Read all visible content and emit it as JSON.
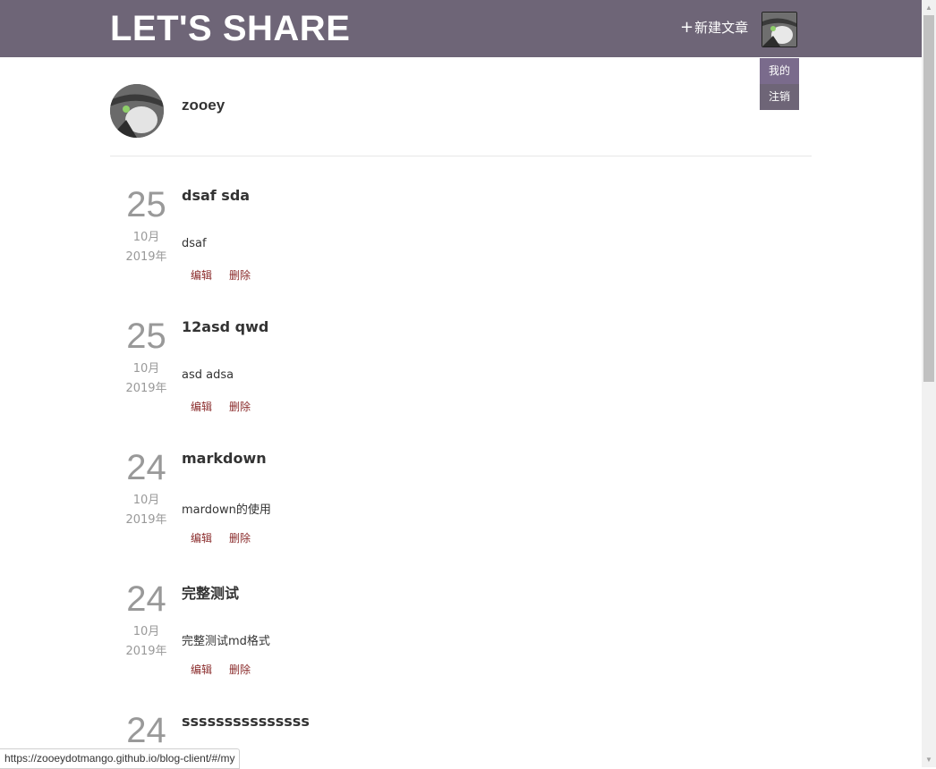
{
  "header": {
    "logo": "LET'S SHARE",
    "new_post_icon": "plus-icon",
    "new_post_label": "新建文章",
    "avatar_icon": "user-avatar-icon",
    "background_color": "#6e6577"
  },
  "user_menu": {
    "items": [
      {
        "label": "我的"
      },
      {
        "label": "注销"
      }
    ]
  },
  "profile": {
    "avatar_icon": "user-avatar-icon",
    "username": "zooey"
  },
  "posts": [
    {
      "day": "25",
      "month": "10月",
      "year": "2019年",
      "title": "dsaf sda",
      "excerpt": "dsaf",
      "edit_label": "编辑",
      "delete_label": "删除"
    },
    {
      "day": "25",
      "month": "10月",
      "year": "2019年",
      "title": "12asd qwd",
      "excerpt": "asd adsa",
      "edit_label": "编辑",
      "delete_label": "删除"
    },
    {
      "day": "24",
      "month": "10月",
      "year": "2019年",
      "title": "markdown",
      "excerpt": "mardown的使用",
      "edit_label": "编辑",
      "delete_label": "删除"
    },
    {
      "day": "24",
      "month": "10月",
      "year": "2019年",
      "title": "完整测试",
      "excerpt": "完整测试md格式",
      "edit_label": "编辑",
      "delete_label": "删除"
    },
    {
      "day": "24",
      "title": "sssssssssssssss"
    }
  ],
  "status_bar": {
    "url": "https://zooeydotmango.github.io/blog-client/#/my"
  },
  "colors": {
    "accent": "#6e6577",
    "action_link": "#8a2b2b",
    "date_text": "#999999"
  }
}
